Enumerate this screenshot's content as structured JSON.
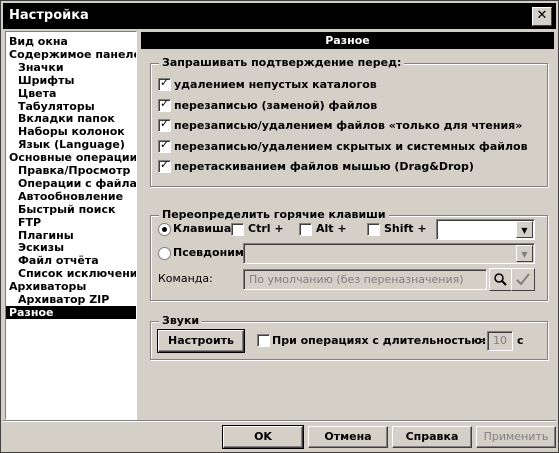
{
  "window": {
    "title": "Настройка",
    "close": "✕"
  },
  "tree": {
    "items": [
      {
        "label": "Вид окна",
        "level": 0
      },
      {
        "label": "Содержимое панелей",
        "level": 0
      },
      {
        "label": "Значки",
        "level": 1
      },
      {
        "label": "Шрифты",
        "level": 1
      },
      {
        "label": "Цвета",
        "level": 1
      },
      {
        "label": "Табуляторы",
        "level": 1
      },
      {
        "label": "Вкладки папок",
        "level": 1
      },
      {
        "label": "Наборы колонок",
        "level": 1
      },
      {
        "label": "Язык (Language)",
        "level": 1
      },
      {
        "label": "Основные операции",
        "level": 0
      },
      {
        "label": "Правка/Просмотр",
        "level": 1
      },
      {
        "label": "Операции с файлам",
        "level": 1
      },
      {
        "label": "Автообновление",
        "level": 1
      },
      {
        "label": "Быстрый поиск",
        "level": 1
      },
      {
        "label": "FTP",
        "level": 1
      },
      {
        "label": "Плагины",
        "level": 1
      },
      {
        "label": "Эскизы",
        "level": 1
      },
      {
        "label": "Файл отчёта",
        "level": 1
      },
      {
        "label": "Список исключений",
        "level": 1
      },
      {
        "label": "Архиваторы",
        "level": 0
      },
      {
        "label": "Архиватор ZIP",
        "level": 1
      },
      {
        "label": "Разное",
        "level": 0,
        "selected": true
      }
    ]
  },
  "panel": {
    "title": "Разное"
  },
  "confirm": {
    "legend": "Запрашивать подтверждение перед:",
    "items": [
      {
        "label": "удалением непустых каталогов",
        "checked": true
      },
      {
        "label": "перезаписью (заменой) файлов",
        "checked": true
      },
      {
        "label": "перезаписью/удалением файлов «только для чтения»",
        "checked": true
      },
      {
        "label": "перезаписью/удалением скрытых и системных файлов",
        "checked": true
      },
      {
        "label": "перетаскиванием файлов мышью (Drag&Drop)",
        "checked": true
      }
    ]
  },
  "hotkeys": {
    "legend": "Переопределить горячие клавиши",
    "key_radio": "Клавиша:",
    "ctrl": "Ctrl +",
    "alt": "Alt +",
    "shift": "Shift +",
    "alias_radio": "Псевдоним:",
    "command_label": "Команда:",
    "command_placeholder": "По умолчанию (без переназначения)"
  },
  "sounds": {
    "legend": "Звуки",
    "configure": "Настроить",
    "duration_label": "При операциях с длительностью:",
    "gt": ">",
    "seconds": "10",
    "unit": "с"
  },
  "buttons": {
    "ok": "OK",
    "cancel": "Отмена",
    "help": "Справка",
    "apply": "Применить"
  }
}
